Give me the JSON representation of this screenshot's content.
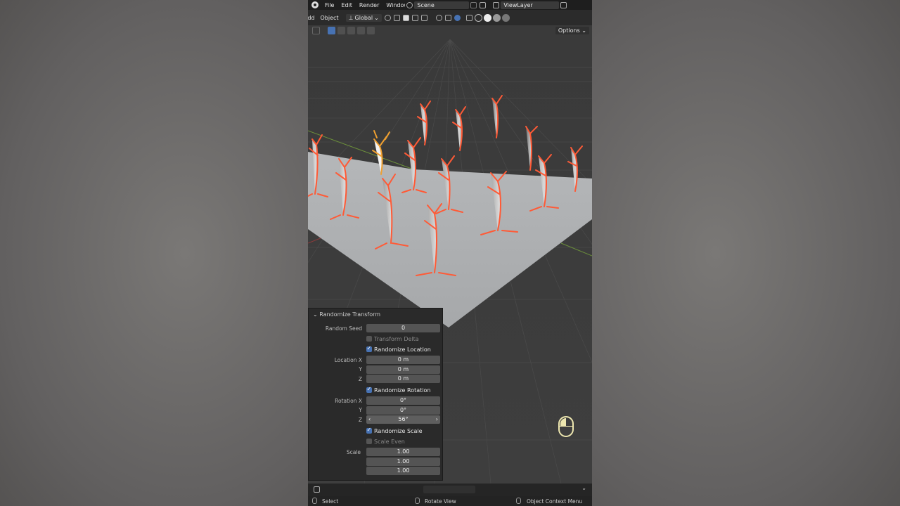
{
  "menu": {
    "file": "File",
    "edit": "Edit",
    "render": "Render",
    "window": "Window",
    "scene": "Scene",
    "view_layer": "ViewLayer"
  },
  "header": {
    "add": "Add",
    "object": "Object",
    "orientation": "Global",
    "options": "Options"
  },
  "panel": {
    "title": "Randomize Transform",
    "random_seed_label": "Random Seed",
    "random_seed_value": "0",
    "transform_delta": "Transform Delta",
    "randomize_location": "Randomize Location",
    "location_x_label": "Location X",
    "location_y_label": "Y",
    "location_z_label": "Z",
    "location_x": "0 m",
    "location_y": "0 m",
    "location_z": "0 m",
    "randomize_rotation": "Randomize Rotation",
    "rotation_x_label": "Rotation X",
    "rotation_y_label": "Y",
    "rotation_z_label": "Z",
    "rotation_x": "0°",
    "rotation_y": "0°",
    "rotation_z": "56°",
    "randomize_scale": "Randomize Scale",
    "scale_even": "Scale Even",
    "scale_label": "Scale",
    "scale_x": "1.00",
    "scale_y": "1.00",
    "scale_z": "1.00"
  },
  "status": {
    "select": "Select",
    "rotate_view": "Rotate View",
    "context_menu": "Object Context Menu"
  },
  "colors": {
    "accent": "#4772b3",
    "selection_outline": "#ff5a36",
    "active_outline": "#f0a030"
  }
}
